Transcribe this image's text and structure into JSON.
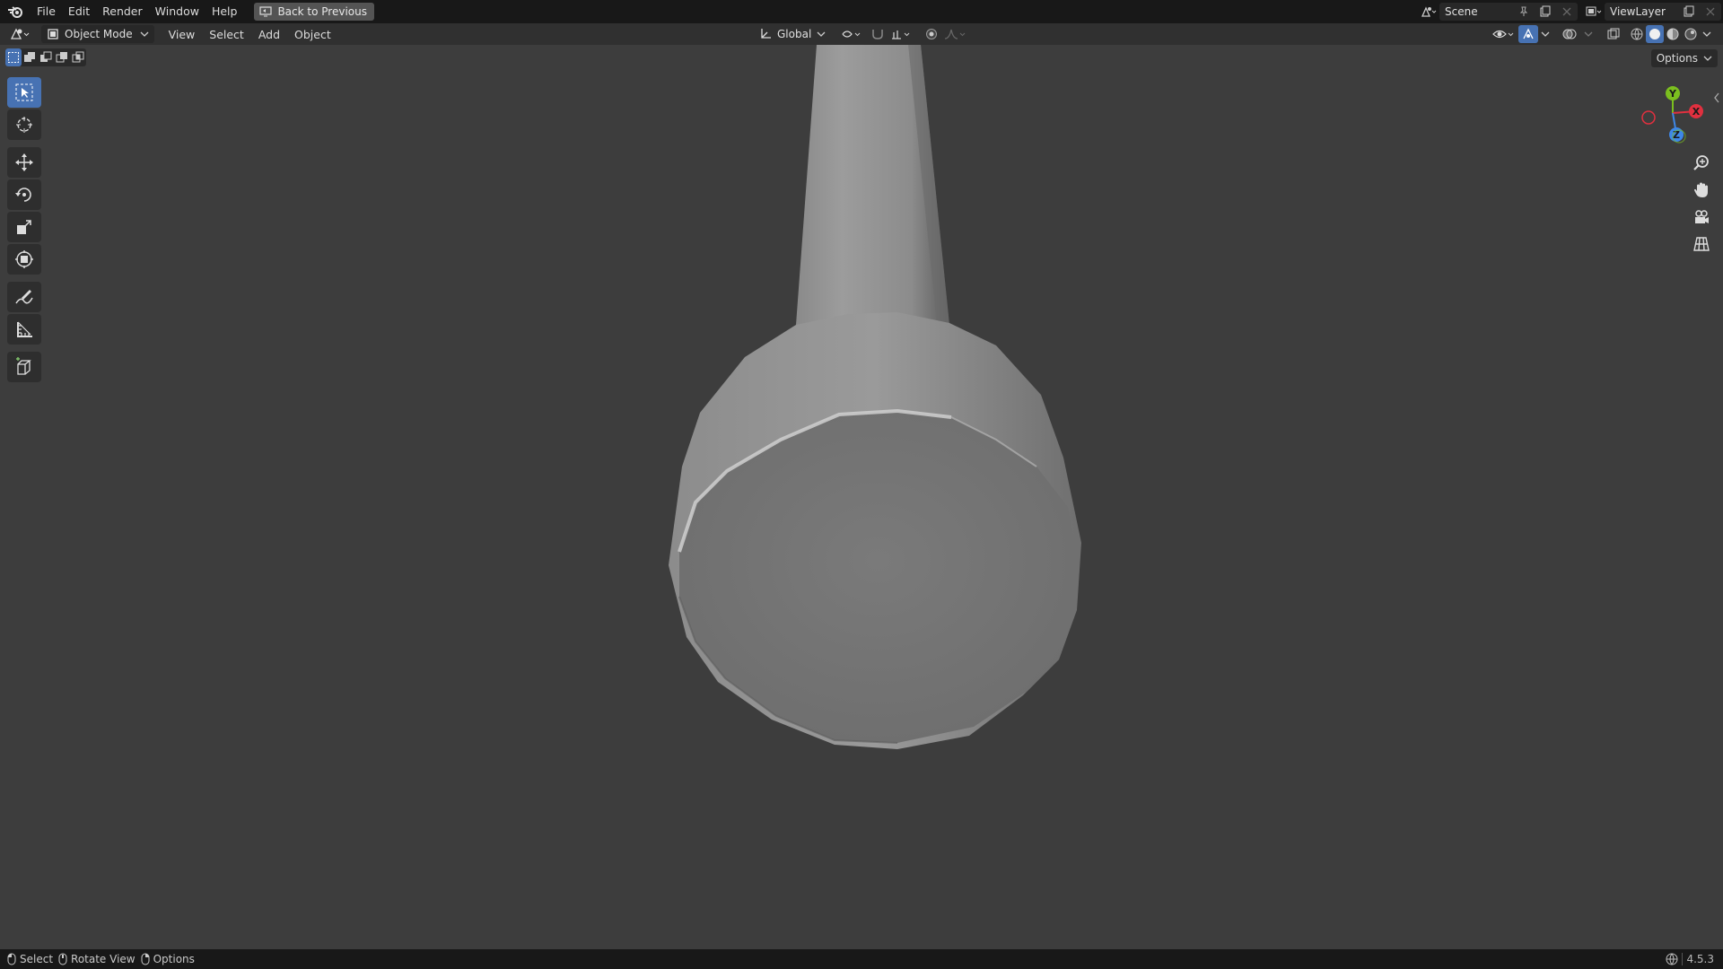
{
  "topbar": {
    "menu": [
      "File",
      "Edit",
      "Render",
      "Window",
      "Help"
    ],
    "back_button": "Back to Previous",
    "scene_name": "Scene",
    "view_layer_name": "ViewLayer"
  },
  "header": {
    "mode": "Object Mode",
    "menus": [
      "View",
      "Select",
      "Add",
      "Object"
    ],
    "orientation": "Global",
    "options_label": "Options"
  },
  "gizmo": {
    "y_label": "Y",
    "x_label": "X",
    "z_label": "Z",
    "colors": {
      "x": "#e0303f",
      "y": "#7bbf1f",
      "z": "#3e88e8"
    }
  },
  "statusbar": {
    "select": "Select",
    "rotate_view": "Rotate View",
    "options": "Options",
    "version": "4.5.3"
  },
  "theme": {
    "viewport_bg": "#3d3d3d",
    "accent": "#4772b3"
  }
}
